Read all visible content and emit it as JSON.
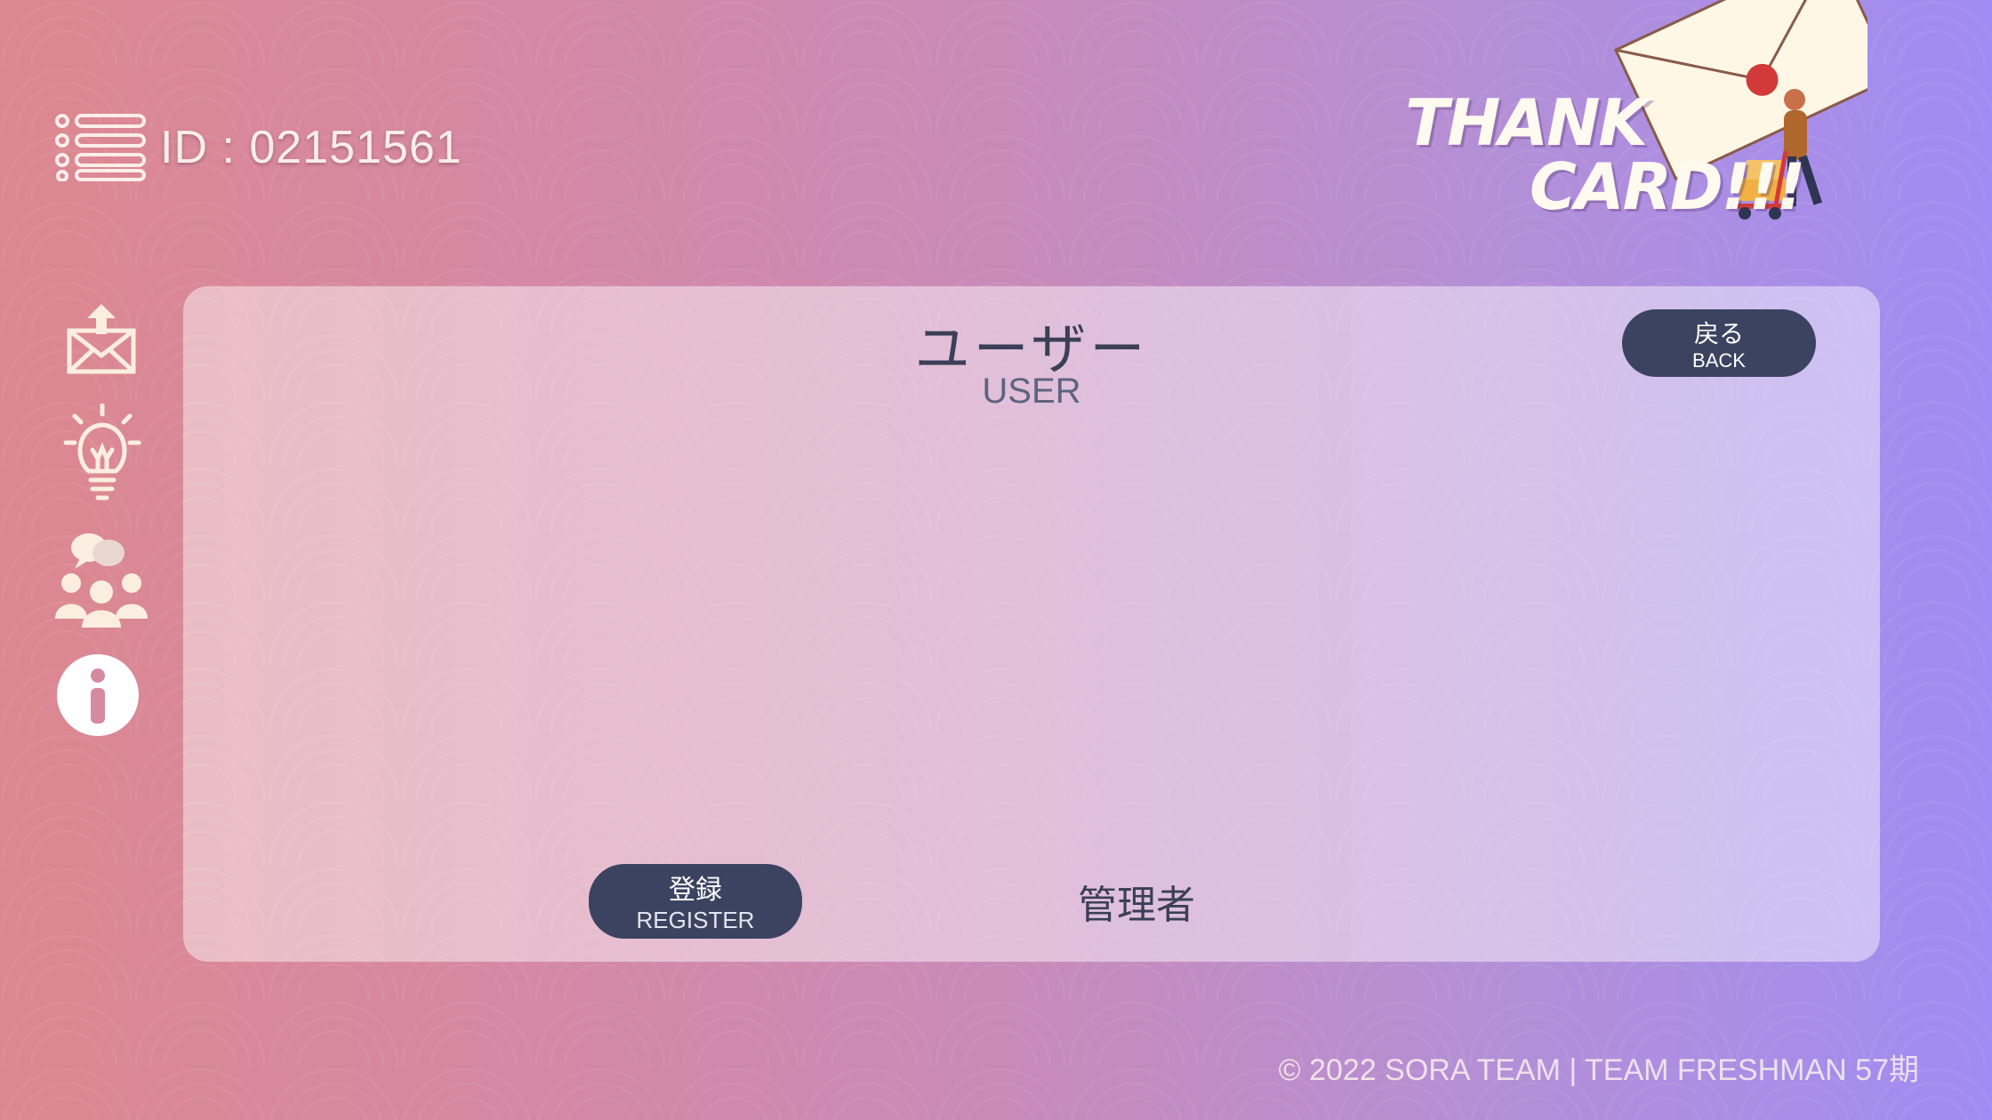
{
  "header": {
    "user_id": "ID : 02151561",
    "menu_icon": "list-menu-icon"
  },
  "logo": {
    "line1": "THANK",
    "line2": "CARD!!!"
  },
  "sidebar": {
    "items": [
      {
        "icon": "mail-send-icon"
      },
      {
        "icon": "lightbulb-icon"
      },
      {
        "icon": "community-chat-icon"
      },
      {
        "icon": "info-icon"
      }
    ]
  },
  "main": {
    "title": "ユーザー",
    "subtitle": "USER",
    "back_button": {
      "jp": "戻る",
      "en": "BACK"
    },
    "register_button": {
      "jp": "登録",
      "en": "REGISTER"
    },
    "admin_label": "管理者"
  },
  "footer": {
    "copyright": "© 2022 SORA TEAM | TEAM FRESHMAN 57期"
  },
  "colors": {
    "button": "#3c4360",
    "text_dark": "#3b3f57",
    "icon_cream": "#fbeee0"
  }
}
